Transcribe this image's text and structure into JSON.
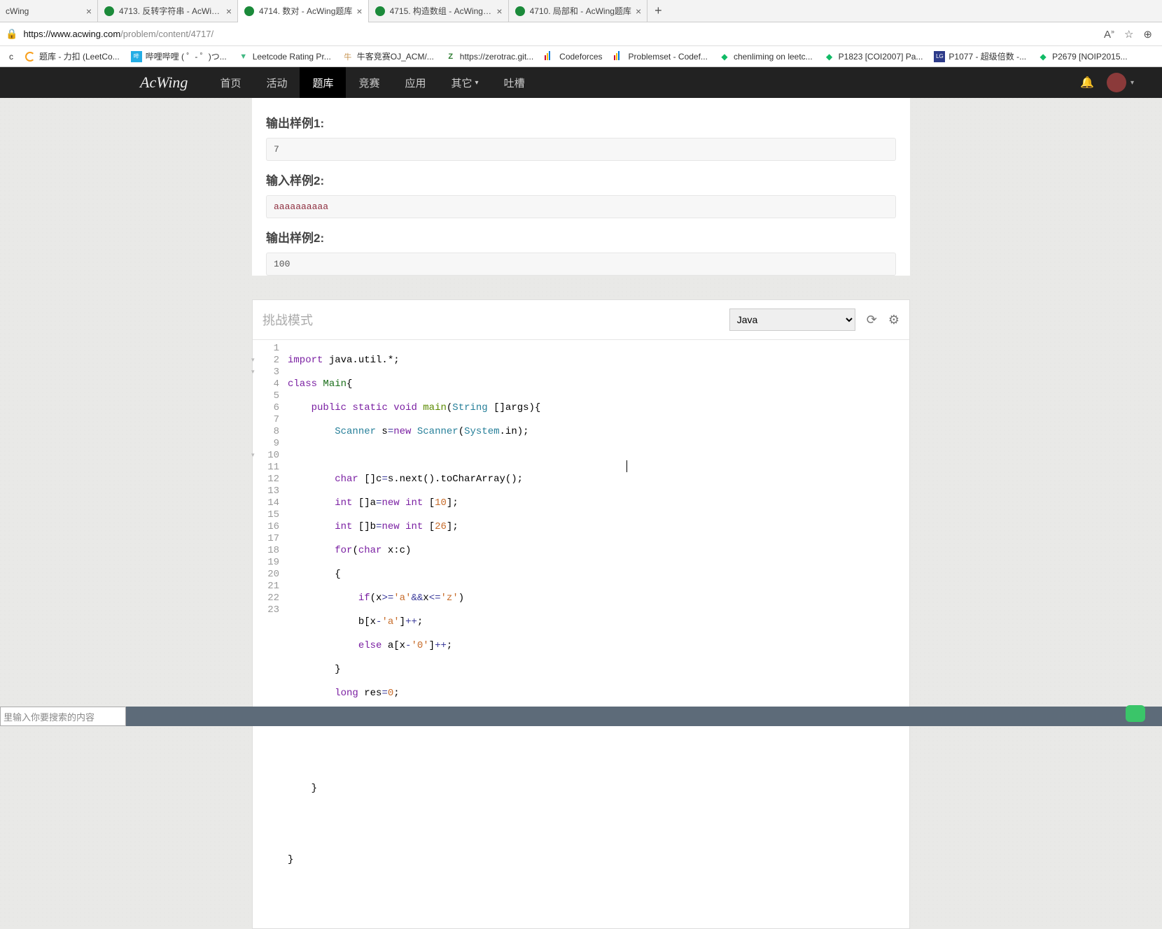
{
  "tabs": [
    {
      "title": "cWing"
    },
    {
      "title": "4713. 反转字符串 - AcWing题库"
    },
    {
      "title": "4714. 数对 - AcWing题库",
      "active": true
    },
    {
      "title": "4715. 构造数组 - AcWing题库"
    },
    {
      "title": "4710. 局部和 - AcWing题库"
    }
  ],
  "url": {
    "host": "https://www.acwing.com",
    "path": "/problem/content/4717/"
  },
  "bookmarks": [
    {
      "label": "c"
    },
    {
      "label": "题库 - 力扣 (LeetCo..."
    },
    {
      "label": "哔哩哔哩 (  ゜- ゜)つ..."
    },
    {
      "label": "Leetcode Rating Pr..."
    },
    {
      "label": "牛客竞赛OJ_ACM/..."
    },
    {
      "label": "https://zerotrac.git..."
    },
    {
      "label": "Codeforces"
    },
    {
      "label": "Problemset - Codef..."
    },
    {
      "label": "chenliming on leetc..."
    },
    {
      "label": "P1823 [COI2007] Pa..."
    },
    {
      "label": "P1077 - 超级倍数 -..."
    },
    {
      "label": "P2679 [NOIP2015..."
    }
  ],
  "nav": {
    "brand": "AcWing",
    "items": [
      "首页",
      "活动",
      "题库",
      "竞赛",
      "应用",
      "其它",
      "吐槽"
    ],
    "active": "题库"
  },
  "problem": {
    "out1_title": "输出样例1:",
    "out1_val": "7",
    "in2_title": "输入样例2:",
    "in2_val": "aaaaaaaaaa",
    "out2_title": "输出样例2:",
    "out2_val": "100"
  },
  "editor": {
    "mode_placeholder": "挑战模式",
    "language": "Java",
    "lines": [
      1,
      2,
      3,
      4,
      5,
      6,
      7,
      8,
      9,
      10,
      11,
      12,
      13,
      14,
      15,
      16,
      17,
      18,
      19,
      20,
      21,
      22,
      23
    ],
    "folds": [
      2,
      3,
      10
    ]
  },
  "search_placeholder": "里输入你要搜索的内容"
}
